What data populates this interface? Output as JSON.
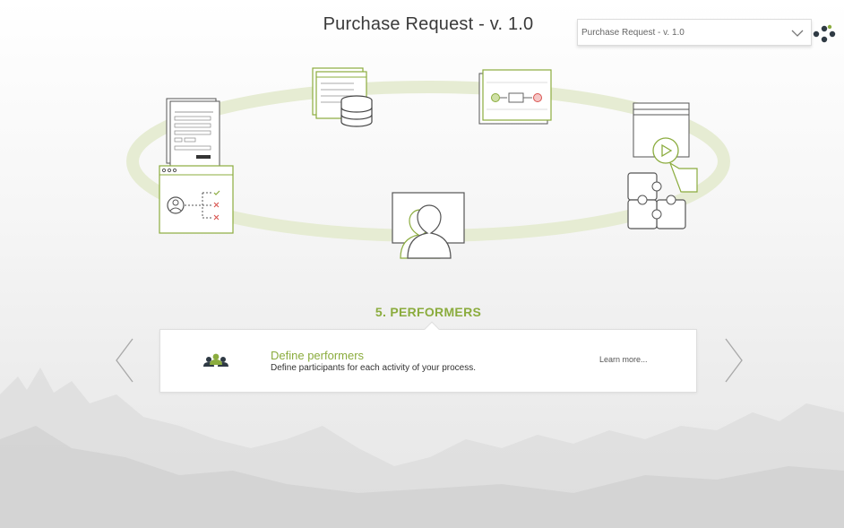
{
  "header": {
    "title": "Purchase Request - v. 1.0"
  },
  "version_select": {
    "value": "Purchase Request - v. 1.0"
  },
  "icons": {
    "logo": "app-logo-icon",
    "chevron": "chevron-down-icon",
    "prev": "chevron-left-icon",
    "next": "chevron-right-icon",
    "performers": "performers-icon"
  },
  "colors": {
    "accent": "#8bac3e",
    "text": "#3a3a3a",
    "line": "#555555",
    "wheel": "#e6ecd3",
    "error": "#d9534f"
  },
  "wheel_steps": [
    {
      "icon": "form-document-icon"
    },
    {
      "icon": "data-database-icon"
    },
    {
      "icon": "workflow-diagram-icon"
    },
    {
      "icon": "run-integration-icon"
    },
    {
      "icon": "performers-monitor-icon"
    },
    {
      "icon": "rules-decision-icon"
    }
  ],
  "active_step": {
    "title": "5. PERFORMERS",
    "heading": "Define performers",
    "description": "Define participants for each activity of your process.",
    "link": "Learn more..."
  }
}
